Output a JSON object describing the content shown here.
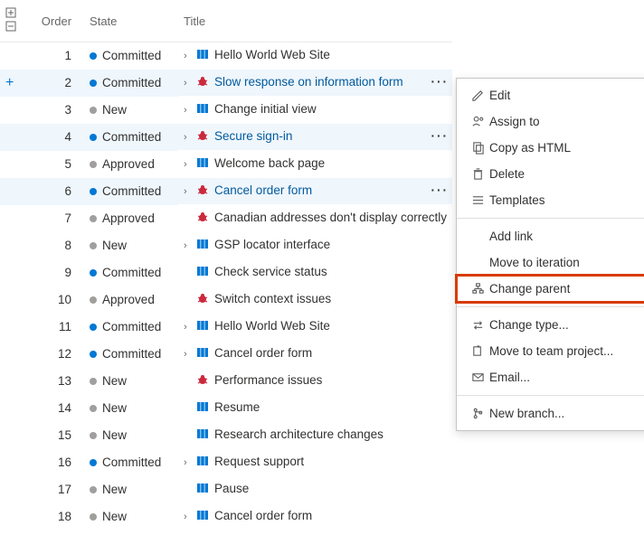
{
  "headers": {
    "order": "Order",
    "state": "State",
    "title": "Title"
  },
  "rows": [
    {
      "order": "1",
      "state": "Committed",
      "dot": "blue",
      "chev": true,
      "icon": "pbi",
      "title": "Hello World Web Site",
      "selected": false,
      "more": false,
      "link": false,
      "add": false
    },
    {
      "order": "2",
      "state": "Committed",
      "dot": "blue",
      "chev": true,
      "icon": "bug",
      "title": "Slow response on information form",
      "selected": true,
      "more": true,
      "link": true,
      "add": true
    },
    {
      "order": "3",
      "state": "New",
      "dot": "gray",
      "chev": true,
      "icon": "pbi",
      "title": "Change initial view",
      "selected": false,
      "more": false,
      "link": false,
      "add": false
    },
    {
      "order": "4",
      "state": "Committed",
      "dot": "blue",
      "chev": true,
      "icon": "bug",
      "title": "Secure sign-in",
      "selected": true,
      "more": true,
      "link": true,
      "add": false
    },
    {
      "order": "5",
      "state": "Approved",
      "dot": "gray",
      "chev": true,
      "icon": "pbi",
      "title": "Welcome back page",
      "selected": false,
      "more": false,
      "link": false,
      "add": false
    },
    {
      "order": "6",
      "state": "Committed",
      "dot": "blue",
      "chev": true,
      "icon": "bug",
      "title": "Cancel order form",
      "selected": true,
      "more": true,
      "link": true,
      "add": false
    },
    {
      "order": "7",
      "state": "Approved",
      "dot": "gray",
      "chev": false,
      "icon": "bug",
      "title": "Canadian addresses don't display correctly",
      "selected": false,
      "more": false,
      "link": false,
      "add": false
    },
    {
      "order": "8",
      "state": "New",
      "dot": "gray",
      "chev": true,
      "icon": "pbi",
      "title": "GSP locator interface",
      "selected": false,
      "more": false,
      "link": false,
      "add": false
    },
    {
      "order": "9",
      "state": "Committed",
      "dot": "blue",
      "chev": false,
      "icon": "pbi",
      "title": "Check service status",
      "selected": false,
      "more": false,
      "link": false,
      "add": false
    },
    {
      "order": "10",
      "state": "Approved",
      "dot": "gray",
      "chev": false,
      "icon": "bug",
      "title": "Switch context issues",
      "selected": false,
      "more": false,
      "link": false,
      "add": false
    },
    {
      "order": "11",
      "state": "Committed",
      "dot": "blue",
      "chev": true,
      "icon": "pbi",
      "title": "Hello World Web Site",
      "selected": false,
      "more": false,
      "link": false,
      "add": false
    },
    {
      "order": "12",
      "state": "Committed",
      "dot": "blue",
      "chev": true,
      "icon": "pbi",
      "title": "Cancel order form",
      "selected": false,
      "more": false,
      "link": false,
      "add": false
    },
    {
      "order": "13",
      "state": "New",
      "dot": "gray",
      "chev": false,
      "icon": "bug",
      "title": "Performance issues",
      "selected": false,
      "more": false,
      "link": false,
      "add": false
    },
    {
      "order": "14",
      "state": "New",
      "dot": "gray",
      "chev": false,
      "icon": "pbi",
      "title": "Resume",
      "selected": false,
      "more": false,
      "link": false,
      "add": false
    },
    {
      "order": "15",
      "state": "New",
      "dot": "gray",
      "chev": false,
      "icon": "pbi",
      "title": "Research architecture changes",
      "selected": false,
      "more": false,
      "link": false,
      "add": false
    },
    {
      "order": "16",
      "state": "Committed",
      "dot": "blue",
      "chev": true,
      "icon": "pbi",
      "title": "Request support",
      "selected": false,
      "more": false,
      "link": false,
      "add": false
    },
    {
      "order": "17",
      "state": "New",
      "dot": "gray",
      "chev": false,
      "icon": "pbi",
      "title": "Pause",
      "selected": false,
      "more": false,
      "link": false,
      "add": false
    },
    {
      "order": "18",
      "state": "New",
      "dot": "gray",
      "chev": true,
      "icon": "pbi",
      "title": "Cancel order form",
      "selected": false,
      "more": false,
      "link": false,
      "add": false
    }
  ],
  "context_menu": [
    {
      "icon": "edit",
      "label": "Edit",
      "arrow": false,
      "highlight": false
    },
    {
      "icon": "assign",
      "label": "Assign to",
      "arrow": true,
      "highlight": false
    },
    {
      "icon": "copy",
      "label": "Copy as HTML",
      "arrow": false,
      "highlight": false
    },
    {
      "icon": "delete",
      "label": "Delete",
      "arrow": false,
      "highlight": false
    },
    {
      "icon": "templates",
      "label": "Templates",
      "arrow": true,
      "highlight": false
    },
    {
      "sep": true
    },
    {
      "icon": "",
      "label": "Add link",
      "arrow": true,
      "highlight": false
    },
    {
      "icon": "",
      "label": "Move to iteration",
      "arrow": true,
      "highlight": false
    },
    {
      "icon": "parent",
      "label": "Change parent",
      "arrow": false,
      "highlight": true
    },
    {
      "sep": true
    },
    {
      "icon": "changetype",
      "label": "Change type...",
      "arrow": false,
      "highlight": false
    },
    {
      "icon": "move",
      "label": "Move to team project...",
      "arrow": false,
      "highlight": false
    },
    {
      "icon": "email",
      "label": "Email...",
      "arrow": false,
      "highlight": false
    },
    {
      "sep": true
    },
    {
      "icon": "branch",
      "label": "New branch...",
      "arrow": false,
      "highlight": false
    }
  ]
}
